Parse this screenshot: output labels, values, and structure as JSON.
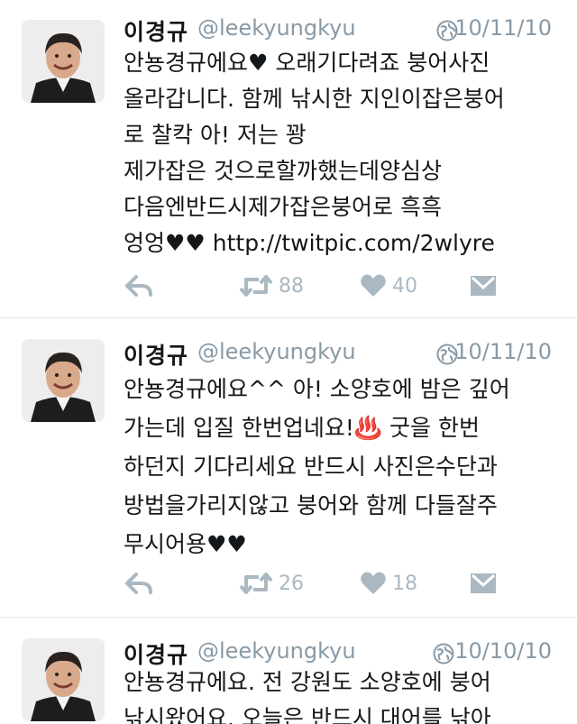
{
  "colors": {
    "secondary_text": "#8899a6",
    "action_icon": "#aab8c2",
    "divider": "#e1e8ed"
  },
  "tweets": [
    {
      "name": "이경규",
      "handle": "@leekyungkyu",
      "date": "10/11/10",
      "text": "안뇽경규에요♥ 오래기다려죠 붕어사진\n올라갑니다. 함께 낚시한 지인이잡은붕어\n로 찰칵 아! 저는 꽝\n제가잡은 것으로할까했는데양심상\n다음엔반드시제가잡은붕어로 흑흑\n엉엉♥♥ http://twitpic.com/2wlyre",
      "retweets": "88",
      "likes": "40"
    },
    {
      "name": "이경규",
      "handle": "@leekyungkyu",
      "date": "10/11/10",
      "text": "안뇽경규에요^^ 아! 소양호에 밤은 깊어\n가는데 입질 한번업네요!♨️ 굿을 한번\n하던지 기다리세요 반드시 사진은수단과\n방법을가리지않고 붕어와 함께 다들잘주\n무시어용♥♥",
      "retweets": "26",
      "likes": "18"
    },
    {
      "name": "이경규",
      "handle": "@leekyungkyu",
      "date": "10/10/10",
      "text": "안뇽경규에요. 전 강원도 소양호에 붕어\n낚시왔어요. 오늘은 반드시 대어를 낚아"
    }
  ],
  "icons": {
    "avatar": "profile-photo",
    "globe": "globe-icon",
    "reply": "reply-icon",
    "retweet": "retweet-icon",
    "like": "heart-icon",
    "dm": "direct-message-icon"
  }
}
